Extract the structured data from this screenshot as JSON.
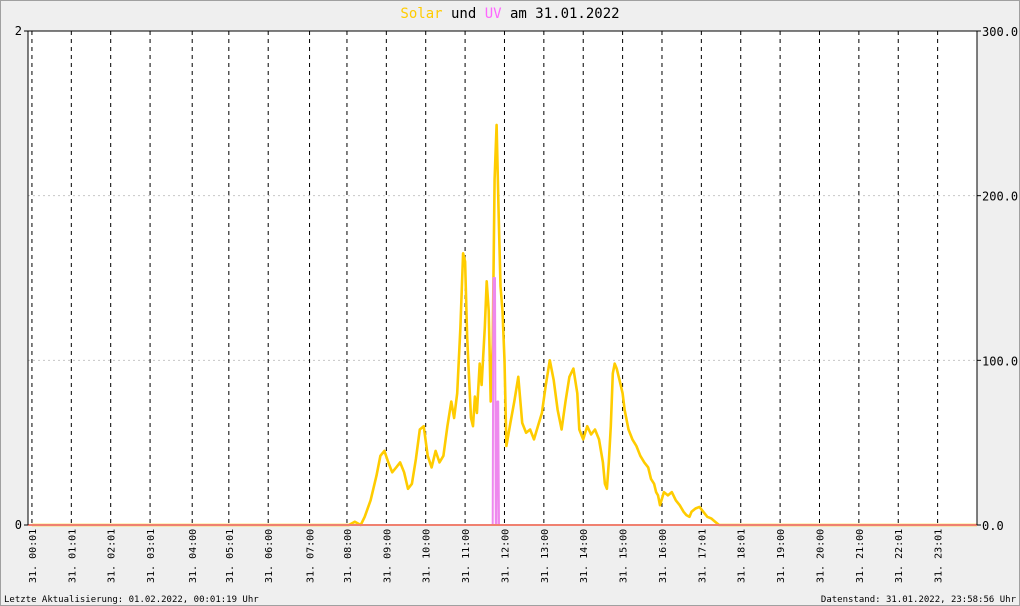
{
  "title": {
    "part1": "Solar",
    "part2": " und ",
    "part3": "UV",
    "part4": " am 31.01.2022",
    "color_solar": "#ffcc00",
    "color_uv": "#ff66ff",
    "color_text": "#000000"
  },
  "footer": {
    "left": "Letzte Aktualisierung: 01.02.2022, 00:01:19 Uhr",
    "right": "Datenstand: 31.01.2022, 23:58:56 Uhr"
  },
  "chart_data": {
    "type": "line",
    "title": "Solar und UV am 31.01.2022",
    "x_ticks": [
      {
        "h": 0.0,
        "line1": "31.",
        "line2": "00:01"
      },
      {
        "h": 1.0,
        "line1": "31.",
        "line2": "01:01"
      },
      {
        "h": 2.0,
        "line1": "31.",
        "line2": "02:01"
      },
      {
        "h": 3.0,
        "line1": "31.",
        "line2": "03:01"
      },
      {
        "h": 4.07,
        "line1": "31.",
        "line2": "04:00"
      },
      {
        "h": 5.0,
        "line1": "31.",
        "line2": "05:01"
      },
      {
        "h": 6.0,
        "line1": "31.",
        "line2": "06:00"
      },
      {
        "h": 7.05,
        "line1": "31.",
        "line2": "07:00"
      },
      {
        "h": 8.0,
        "line1": "31.",
        "line2": "08:00"
      },
      {
        "h": 9.0,
        "line1": "31.",
        "line2": "09:00"
      },
      {
        "h": 10.0,
        "line1": "31.",
        "line2": "10:00"
      },
      {
        "h": 11.0,
        "line1": "31.",
        "line2": "11:00"
      },
      {
        "h": 12.0,
        "line1": "31.",
        "line2": "12:00"
      },
      {
        "h": 13.0,
        "line1": "31.",
        "line2": "13:00"
      },
      {
        "h": 14.0,
        "line1": "31.",
        "line2": "14:00"
      },
      {
        "h": 15.0,
        "line1": "31.",
        "line2": "15:00"
      },
      {
        "h": 16.0,
        "line1": "31.",
        "line2": "16:00"
      },
      {
        "h": 17.0,
        "line1": "31.",
        "line2": "17:01"
      },
      {
        "h": 18.0,
        "line1": "31.",
        "line2": "18:01"
      },
      {
        "h": 19.0,
        "line1": "31.",
        "line2": "19:00"
      },
      {
        "h": 20.0,
        "line1": "31.",
        "line2": "20:00"
      },
      {
        "h": 21.0,
        "line1": "31.",
        "line2": "21:00"
      },
      {
        "h": 22.0,
        "line1": "31.",
        "line2": "22:01"
      },
      {
        "h": 23.0,
        "line1": "31.",
        "line2": "23:01"
      }
    ],
    "x_range_hours": [
      -0.1,
      24.0
    ],
    "y_left": {
      "range": [
        0,
        2
      ],
      "ticks": [
        {
          "v": 0,
          "label": "0"
        },
        {
          "v": 2,
          "label": "2"
        }
      ]
    },
    "y_right": {
      "range": [
        0,
        300
      ],
      "ticks": [
        {
          "v": 0,
          "label": "0.0"
        },
        {
          "v": 100,
          "label": "100.0"
        },
        {
          "v": 200,
          "label": "200.0"
        },
        {
          "v": 300,
          "label": "300.0"
        }
      ]
    },
    "grid": {
      "vertical": "dashed",
      "horizontal": "dotted"
    },
    "series": [
      {
        "key": "solar",
        "axis": "right",
        "color": "#ffcc00",
        "points": [
          [
            0,
            0
          ],
          [
            8.05,
            0
          ],
          [
            8.2,
            2
          ],
          [
            8.35,
            0
          ],
          [
            8.45,
            5
          ],
          [
            8.6,
            15
          ],
          [
            8.75,
            30
          ],
          [
            8.85,
            42
          ],
          [
            8.95,
            45
          ],
          [
            9.05,
            38
          ],
          [
            9.15,
            32
          ],
          [
            9.25,
            35
          ],
          [
            9.35,
            38
          ],
          [
            9.45,
            32
          ],
          [
            9.55,
            22
          ],
          [
            9.65,
            25
          ],
          [
            9.75,
            40
          ],
          [
            9.85,
            58
          ],
          [
            9.95,
            60
          ],
          [
            10.05,
            42
          ],
          [
            10.15,
            35
          ],
          [
            10.25,
            45
          ],
          [
            10.35,
            38
          ],
          [
            10.45,
            42
          ],
          [
            10.55,
            60
          ],
          [
            10.65,
            75
          ],
          [
            10.72,
            65
          ],
          [
            10.8,
            80
          ],
          [
            10.88,
            120
          ],
          [
            10.95,
            165
          ],
          [
            11.0,
            160
          ],
          [
            11.05,
            115
          ],
          [
            11.1,
            90
          ],
          [
            11.15,
            65
          ],
          [
            11.2,
            60
          ],
          [
            11.25,
            78
          ],
          [
            11.3,
            68
          ],
          [
            11.37,
            98
          ],
          [
            11.42,
            85
          ],
          [
            11.5,
            120
          ],
          [
            11.55,
            148
          ],
          [
            11.6,
            130
          ],
          [
            11.65,
            75
          ],
          [
            11.7,
            110
          ],
          [
            11.75,
            210
          ],
          [
            11.8,
            243
          ],
          [
            11.85,
            190
          ],
          [
            11.9,
            145
          ],
          [
            11.95,
            130
          ],
          [
            12.0,
            100
          ],
          [
            12.05,
            48
          ],
          [
            12.15,
            62
          ],
          [
            12.25,
            75
          ],
          [
            12.35,
            90
          ],
          [
            12.45,
            62
          ],
          [
            12.55,
            56
          ],
          [
            12.65,
            58
          ],
          [
            12.75,
            52
          ],
          [
            12.85,
            60
          ],
          [
            12.95,
            68
          ],
          [
            13.05,
            85
          ],
          [
            13.15,
            100
          ],
          [
            13.25,
            88
          ],
          [
            13.35,
            70
          ],
          [
            13.45,
            58
          ],
          [
            13.55,
            75
          ],
          [
            13.65,
            90
          ],
          [
            13.75,
            95
          ],
          [
            13.85,
            80
          ],
          [
            13.9,
            58
          ],
          [
            14.0,
            52
          ],
          [
            14.1,
            60
          ],
          [
            14.2,
            55
          ],
          [
            14.3,
            58
          ],
          [
            14.4,
            52
          ],
          [
            14.5,
            38
          ],
          [
            14.55,
            25
          ],
          [
            14.6,
            22
          ],
          [
            14.65,
            38
          ],
          [
            14.7,
            60
          ],
          [
            14.75,
            92
          ],
          [
            14.8,
            98
          ],
          [
            14.85,
            95
          ],
          [
            14.92,
            88
          ],
          [
            15.0,
            80
          ],
          [
            15.05,
            70
          ],
          [
            15.15,
            58
          ],
          [
            15.25,
            52
          ],
          [
            15.35,
            48
          ],
          [
            15.45,
            42
          ],
          [
            15.55,
            38
          ],
          [
            15.65,
            35
          ],
          [
            15.72,
            28
          ],
          [
            15.8,
            25
          ],
          [
            15.85,
            20
          ],
          [
            15.9,
            18
          ],
          [
            15.95,
            12
          ],
          [
            16.05,
            20
          ],
          [
            16.15,
            18
          ],
          [
            16.25,
            20
          ],
          [
            16.35,
            15
          ],
          [
            16.45,
            12
          ],
          [
            16.55,
            8
          ],
          [
            16.62,
            6
          ],
          [
            16.7,
            5
          ],
          [
            16.75,
            8
          ],
          [
            16.85,
            10
          ],
          [
            16.95,
            11
          ],
          [
            17.05,
            8
          ],
          [
            17.15,
            5
          ],
          [
            17.25,
            4
          ],
          [
            17.35,
            2
          ],
          [
            17.45,
            0
          ],
          [
            17.55,
            0
          ],
          [
            24.0,
            0
          ]
        ]
      },
      {
        "key": "uv",
        "axis": "left",
        "color": "#ee88ee",
        "points": [
          [
            0,
            0
          ],
          [
            11.7,
            0
          ],
          [
            11.72,
            1.0
          ],
          [
            11.76,
            1.0
          ],
          [
            11.78,
            0
          ],
          [
            11.8,
            0
          ],
          [
            11.82,
            0.5
          ],
          [
            11.84,
            0.5
          ],
          [
            11.86,
            0
          ],
          [
            24.0,
            0
          ]
        ]
      }
    ]
  }
}
